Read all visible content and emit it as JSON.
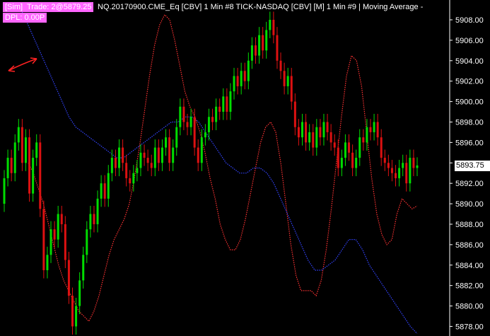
{
  "header": {
    "sim_label": "[Sim]",
    "trade_label": "Trade: 2@5879.25",
    "dpl_label": "DPL: 0.00P",
    "series_info": "NQ.20170900.CME_Eq [CBV]  1 Min   #8 TICK-NASDAQ [CBV] [M]  1 Min   #9 | Moving Average -"
  },
  "colors": {
    "background": "#000000",
    "candle_up": "#00dd00",
    "candle_down": "#dd1111",
    "tick_line": "#ff3333",
    "moving_average": "#3344ff",
    "annotation": "#ff2222",
    "badge": "#ff66ff"
  },
  "last_price": "5893.75",
  "chart_data": {
    "type": "candlestick",
    "y_axis": {
      "ticks": [
        "5908.00",
        "5906.00",
        "5904.00",
        "5902.00",
        "5900.00",
        "5898.00",
        "5896.00",
        "5894.00",
        "5892.00",
        "5890.00",
        "5888.00",
        "5886.00",
        "5884.00",
        "5882.00",
        "5880.00",
        "5878.00"
      ],
      "range": [
        5877.2,
        5909.8
      ]
    },
    "candles_close": [
      5892.5,
      5894.5,
      5893.0,
      5896.0,
      5897.5,
      5894.0,
      5896.5,
      5891.0,
      5894.5,
      5896.0,
      5889.5,
      5883.5,
      5885.0,
      5887.5,
      5886.5,
      5889.0,
      5888.0,
      5884.5,
      5881.0,
      5878.0,
      5880.0,
      5882.5,
      5885.0,
      5887.5,
      5889.0,
      5888.0,
      5890.5,
      5892.0,
      5890.5,
      5893.0,
      5894.5,
      5893.5,
      5895.5,
      5894.0,
      5892.5,
      5892.0,
      5893.0,
      5893.5,
      5895.0,
      5894.5,
      5894.0,
      5893.5,
      5895.5,
      5894.0,
      5895.5,
      5896.5,
      5894.0,
      5895.5,
      5897.5,
      5899.5,
      5898.0,
      5897.5,
      5898.5,
      5895.5,
      5894.0,
      5896.5,
      5897.0,
      5898.5,
      5898.0,
      5899.5,
      5899.0,
      5900.5,
      5899.0,
      5901.0,
      5902.5,
      5901.5,
      5903.0,
      5902.0,
      5904.0,
      5905.5,
      5904.5,
      5906.5,
      5905.0,
      5907.0,
      5908.0,
      5906.5,
      5904.0,
      5903.0,
      5901.5,
      5902.5,
      5900.0,
      5897.5,
      5896.5,
      5898.0,
      5896.0,
      5897.0,
      5895.5,
      5897.5,
      5896.5,
      5898.0,
      5897.0,
      5896.0,
      5895.5,
      5893.5,
      5894.5,
      5896.0,
      5895.0,
      5893.5,
      5894.5,
      5896.5,
      5896.0,
      5897.5,
      5897.0,
      5898.0,
      5896.5,
      5894.5,
      5894.0,
      5893.5,
      5893.0,
      5892.5,
      5893.5,
      5894.0,
      5892.0,
      5894.5,
      5893.5,
      5893.75
    ],
    "candles_open": [
      5890.0,
      5892.5,
      5894.5,
      5893.0,
      5896.0,
      5897.5,
      5894.0,
      5896.5,
      5891.0,
      5894.5,
      5896.0,
      5889.5,
      5883.5,
      5885.0,
      5887.5,
      5886.5,
      5889.0,
      5888.0,
      5884.5,
      5881.0,
      5878.0,
      5880.0,
      5882.5,
      5885.0,
      5887.5,
      5889.0,
      5888.0,
      5890.5,
      5892.0,
      5890.5,
      5893.0,
      5894.5,
      5893.5,
      5895.5,
      5894.0,
      5892.5,
      5892.0,
      5893.0,
      5893.5,
      5895.0,
      5894.5,
      5894.0,
      5893.5,
      5895.5,
      5894.0,
      5895.5,
      5896.5,
      5894.0,
      5895.5,
      5897.5,
      5899.5,
      5898.0,
      5897.5,
      5898.5,
      5895.5,
      5894.0,
      5896.5,
      5897.0,
      5898.5,
      5898.0,
      5899.5,
      5899.0,
      5900.5,
      5899.0,
      5901.0,
      5902.5,
      5901.5,
      5903.0,
      5902.0,
      5904.0,
      5905.5,
      5904.5,
      5906.5,
      5905.0,
      5907.0,
      5908.0,
      5906.5,
      5904.0,
      5903.0,
      5901.5,
      5902.5,
      5900.0,
      5897.5,
      5896.5,
      5898.0,
      5896.0,
      5897.0,
      5895.5,
      5897.5,
      5896.5,
      5898.0,
      5897.0,
      5896.0,
      5895.5,
      5893.5,
      5894.5,
      5896.0,
      5895.0,
      5893.5,
      5894.5,
      5896.5,
      5896.0,
      5897.5,
      5897.0,
      5898.0,
      5896.5,
      5894.5,
      5894.0,
      5893.5,
      5893.0,
      5892.5,
      5893.5,
      5894.0,
      5892.0,
      5894.5,
      5893.5
    ],
    "tick_line": [
      5894.0,
      5893.0,
      5891.5,
      5890.0,
      5888.0,
      5886.0,
      5884.0,
      5882.5,
      5881.5,
      5880.5,
      5879.5,
      5879.0,
      5878.5,
      5879.5,
      5881.0,
      5883.0,
      5885.0,
      5886.5,
      5887.5,
      5888.5,
      5890.0,
      5892.5,
      5895.5,
      5899.0,
      5902.5,
      5905.5,
      5907.5,
      5908.5,
      5908.0,
      5906.0,
      5903.5,
      5901.0,
      5899.5,
      5898.5,
      5897.0,
      5895.0,
      5892.5,
      5890.5,
      5888.0,
      5886.5,
      5885.5,
      5885.5,
      5886.5,
      5888.5,
      5891.0,
      5893.5,
      5896.0,
      5897.5,
      5898.0,
      5897.0,
      5894.0,
      5890.0,
      5886.0,
      5883.0,
      5881.5,
      5881.5,
      5881.5,
      5881.0,
      5882.5,
      5885.5,
      5889.5,
      5894.0,
      5898.5,
      5902.5,
      5904.5,
      5904.0,
      5901.5,
      5897.0,
      5892.5,
      5889.0,
      5887.0,
      5886.0,
      5886.5,
      5889.0,
      5890.5,
      5890.0,
      5889.5,
      5889.8
    ],
    "moving_average": [
      5909.0,
      5907.5,
      5906.0,
      5904.5,
      5903.0,
      5901.5,
      5900.0,
      5898.5,
      5897.5,
      5897.0,
      5896.5,
      5896.0,
      5895.5,
      5895.0,
      5894.5,
      5894.5,
      5895.0,
      5895.5,
      5896.0,
      5896.5,
      5897.0,
      5897.5,
      5898.0,
      5898.0,
      5898.5,
      5898.5,
      5898.0,
      5897.0,
      5896.0,
      5895.0,
      5894.0,
      5893.5,
      5893.0,
      5893.0,
      5893.5,
      5893.5,
      5893.0,
      5892.0,
      5890.5,
      5889.0,
      5887.5,
      5886.0,
      5884.5,
      5883.5,
      5883.5,
      5884.0,
      5884.5,
      5885.5,
      5886.5,
      5886.5,
      5885.5,
      5884.0,
      5883.0,
      5882.0,
      5881.0,
      5880.0,
      5879.0,
      5878.0,
      5877.3
    ]
  }
}
